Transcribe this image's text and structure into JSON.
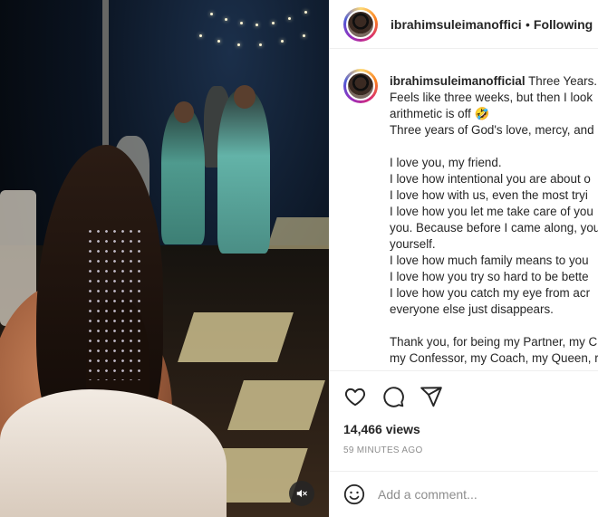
{
  "post": {
    "username": "ibrahimsuleimanofficial",
    "separator": "•",
    "follow_status": "Following"
  },
  "caption": {
    "username": "ibrahimsuleimanofficial",
    "lines": [
      "Three Years.",
      "Feels like three weeks, but then I look",
      "arithmetic is off 🤣",
      "Three years of God's love, mercy, and",
      "",
      "I love you, my friend.",
      "I love how intentional you are about o",
      "I love how with us, even the most tryi",
      "I love how you let me take care of you",
      "you. Because before I came along, you",
      "yourself.",
      "I love how much family means to you",
      "I love how you try so hard to be bette",
      "I love how you catch my eye from acr",
      "everyone else just disappears.",
      "",
      "Thank you, for being my Partner, my C",
      "my Confessor, my Coach, my Queen, r"
    ]
  },
  "stats": {
    "views": "14,466 views",
    "time_ago": "59 MINUTES AGO"
  },
  "comment": {
    "placeholder": "Add a comment..."
  },
  "icons": {
    "like": "heart-icon",
    "comment": "comment-icon",
    "share": "share-icon",
    "emoji": "emoji-icon",
    "mute": "muted-speaker-icon"
  }
}
